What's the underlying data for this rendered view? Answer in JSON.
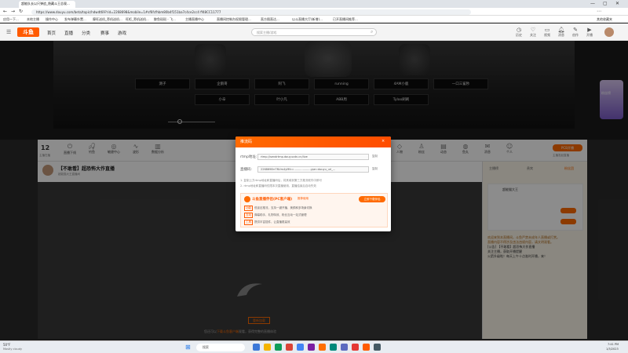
{
  "browser": {
    "tabs": [
      {
        "label": "超能队长以尺弹追_隐藏斗王总观..."
      }
    ],
    "url": "https://www.douyu.com/beta/topic/hdwdt69?rid=2268698&mobile=1#sf6fcfhbm80b4f151ba7c4ce2cc4 ff48CC11777",
    "bookmarks": [
      "应用一下...",
      "本地主播",
      "操作中心",
      "发布弹幕外置...",
      "摩旺送机_旁机送机...",
      "旺柜_旁机送机...",
      "鲸鱼斑斑 - 飞...",
      "主播直播中心",
      "直播间控制台权限管理...",
      "直方图直达...",
      "以斗直播大厅(新增)...",
      "已开直播间推荐...",
      "其他收藏夹"
    ]
  },
  "site": {
    "logo": "斗鱼",
    "nav": [
      "首页",
      "直播",
      "分类",
      "赛事",
      "游戏"
    ],
    "search_placeholder": "搜索主播/游戏",
    "header_icons": [
      {
        "icon": "clock-icon",
        "label": "历史"
      },
      {
        "icon": "heart-icon",
        "label": "关注"
      },
      {
        "icon": "video-icon",
        "label": "视频"
      },
      {
        "icon": "bell-icon",
        "label": "消息"
      },
      {
        "icon": "pencil-icon",
        "label": "创作"
      },
      {
        "icon": "play-icon",
        "label": "开播"
      }
    ]
  },
  "banner": {
    "buttons": [
      "测子",
      "企鹅哥",
      "阿飞",
      "running",
      "4AM小鹿",
      "一口三鲨秒",
      "小辛",
      "叶小凡",
      "ABB周",
      "Tyloo刷刷"
    ],
    "side_badge": "粉丝榜"
  },
  "toolbar": {
    "count": "12",
    "count_label": "主播在播",
    "items": [
      "直播下线",
      "钓鱼",
      "敏捷中心",
      "波形",
      "数据分析",
      "宝藏",
      "主播工具",
      "贡献值",
      "主播助理",
      "充值",
      "平台",
      "更多",
      "拍照",
      "人物",
      "粉丝",
      "动态",
      "鱼丸",
      "消息",
      "个人"
    ],
    "pcb_button": "PCB开播",
    "right_text": "主播发起直播"
  },
  "room": {
    "title": "【不敢看】超恐怖大作直播",
    "subtitle": "超能猫大王直播间"
  },
  "video": {
    "hint_prefix": "您还可以",
    "hint_link": "下载斗鱼客户端",
    "hint_suffix": "观看，获得完整的直播体验",
    "button": "重新加载"
  },
  "modal": {
    "title": "推流码",
    "fields": [
      {
        "label": "rtmp地址:",
        "value": "rtmp://sendrtmp.douyucdn.cn/live",
        "copy": "复制"
      },
      {
        "label": "直播码:",
        "value": "2268698rr7NVm4yMfc=...................ype=douyu_url_...",
        "copy": "复制"
      }
    ],
    "notes": [
      "1. 复制上方rtmp地址和直播码后，将其填到第三方推流软件中即可",
      "2. rtmp地址和直播码仅限本次直播使用，直播结束后自动失效"
    ],
    "promo": {
      "title": "斗鱼直播伴侣(PC客户端)",
      "badge": "推荐使用",
      "download": "立即下载伴侣",
      "rows": [
        {
          "tag": "功能",
          "text": "低延迟推流，支持一键开播、美颜和多场景切换"
        },
        {
          "tag": "互动",
          "text": "弹幕助手、礼物特效、粉丝互动一站式管理"
        },
        {
          "tag": "工具",
          "text": "提供丰富插件，让直播更高效"
        }
      ]
    }
  },
  "right_panel": {
    "tabs": [
      "主播榜",
      "贵宾",
      "粉丝团"
    ],
    "user_name": "超能猫大王",
    "chat_lines": [
      "欢迎来到本直播间，斗鱼严禁未成年人直播或打赏。",
      "直播内容不得涉及违法违规内容，请文明观看。",
      "[公告] 【不敢看】超恐怖大作直播",
      "关注主播，获取开播提醒",
      "火箭升级啦！每天上午十点准时开播，来！"
    ]
  },
  "taskbar": {
    "weather_temp": "50°F",
    "weather_text": "Mostly cloudy",
    "search": "搜索",
    "time": "7:41 PM",
    "date": "1/3/2023"
  }
}
